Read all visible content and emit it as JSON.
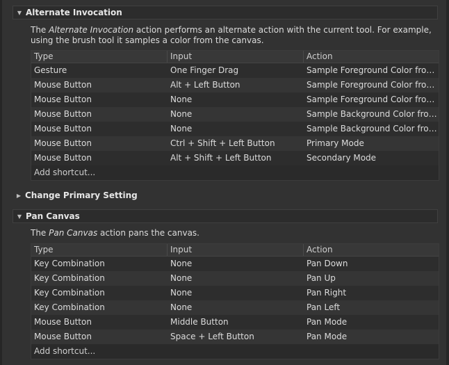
{
  "sections": [
    {
      "title": "Alternate Invocation",
      "expanded": true,
      "description_parts": [
        "The ",
        "Alternate Invocation",
        " action performs an alternate action with the current tool. For example, using the brush tool it samples a color from the canvas."
      ],
      "columns": [
        "Type",
        "Input",
        "Action"
      ],
      "rows": [
        [
          "Gesture",
          "One Finger Drag",
          "Sample Foreground Color from M..."
        ],
        [
          "Mouse Button",
          "Alt + Left Button",
          "Sample Foreground Color from M..."
        ],
        [
          "Mouse Button",
          "None",
          "Sample Foreground Color from C..."
        ],
        [
          "Mouse Button",
          "None",
          "Sample Background Color from C..."
        ],
        [
          "Mouse Button",
          "None",
          "Sample Background Color from ..."
        ],
        [
          "Mouse Button",
          "Ctrl + Shift + Left Button",
          "Primary Mode"
        ],
        [
          "Mouse Button",
          "Alt + Shift + Left Button",
          "Secondary Mode"
        ]
      ],
      "add_label": "Add shortcut..."
    },
    {
      "title": "Change Primary Setting",
      "expanded": false
    },
    {
      "title": "Pan Canvas",
      "expanded": true,
      "description_parts": [
        "The ",
        "Pan Canvas",
        " action pans the canvas."
      ],
      "columns": [
        "Type",
        "Input",
        "Action"
      ],
      "rows": [
        [
          "Key Combination",
          "None",
          "Pan Down"
        ],
        [
          "Key Combination",
          "None",
          "Pan Up"
        ],
        [
          "Key Combination",
          "None",
          "Pan Right"
        ],
        [
          "Key Combination",
          "None",
          "Pan Left"
        ],
        [
          "Mouse Button",
          "Middle Button",
          "Pan Mode"
        ],
        [
          "Mouse Button",
          "Space + Left Button",
          "Pan Mode"
        ]
      ],
      "add_label": "Add shortcut..."
    }
  ],
  "icons": {
    "expanded": "chevron-down-icon",
    "collapsed": "chevron-right-icon"
  }
}
